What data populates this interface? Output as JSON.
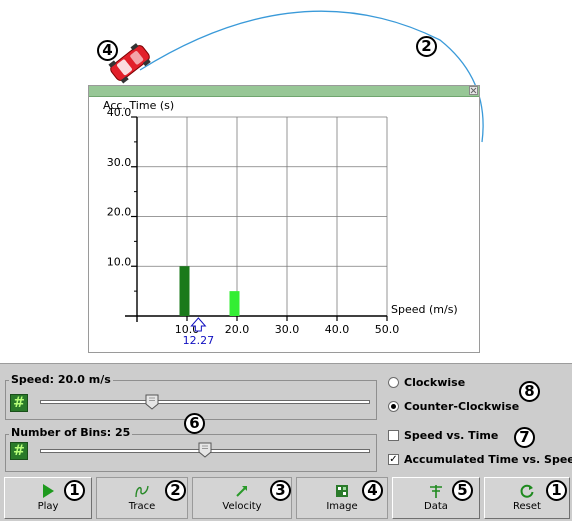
{
  "callouts": {
    "c_car": "4",
    "c_arc": "2",
    "c_bins": "6",
    "c_dir": "8",
    "c_plot": "7",
    "c_play": "1",
    "c_trace": "2",
    "c_velocity": "3",
    "c_image": "4",
    "c_data": "5",
    "c_reset": "1"
  },
  "chart_data": {
    "type": "bar",
    "ylabel": "Acc. Time (s)",
    "xlabel": "Speed (m/s)",
    "ylim": [
      0,
      40
    ],
    "xlim": [
      0,
      50
    ],
    "yticks": [
      "10.0",
      "20.0",
      "30.0",
      "40.0"
    ],
    "xticks": [
      "10.0",
      "20.0",
      "30.0",
      "40.0",
      "50.0"
    ],
    "bars": [
      {
        "x": 9.5,
        "value": 10.0,
        "color": "#1a7a1a"
      },
      {
        "x": 19.5,
        "value": 5.0,
        "color": "#33ee33"
      }
    ],
    "marker": {
      "value": 12.27,
      "label": "12.27",
      "color": "#1010c0"
    }
  },
  "controls": {
    "speed": {
      "label": "Speed: 20.0 m/s",
      "fraction": 0.34
    },
    "bins": {
      "label": "Number of Bins: 25",
      "fraction": 0.5
    },
    "hash_label": "#",
    "direction": {
      "options": [
        "Clockwise",
        "Counter-Clockwise"
      ],
      "selected": "Counter-Clockwise"
    },
    "plots": [
      {
        "label": "Speed vs. Time",
        "checked": false
      },
      {
        "label": "Accumulated Time vs. Speed",
        "checked": true
      }
    ]
  },
  "toolbar": {
    "play": "Play",
    "trace": "Trace",
    "velocity": "Velocity",
    "image": "Image",
    "data": "Data",
    "reset": "Reset"
  },
  "colors": {
    "panel": "#cdcdcd",
    "graph_header": "#97c796",
    "accent_green": "#2a7a2a"
  }
}
